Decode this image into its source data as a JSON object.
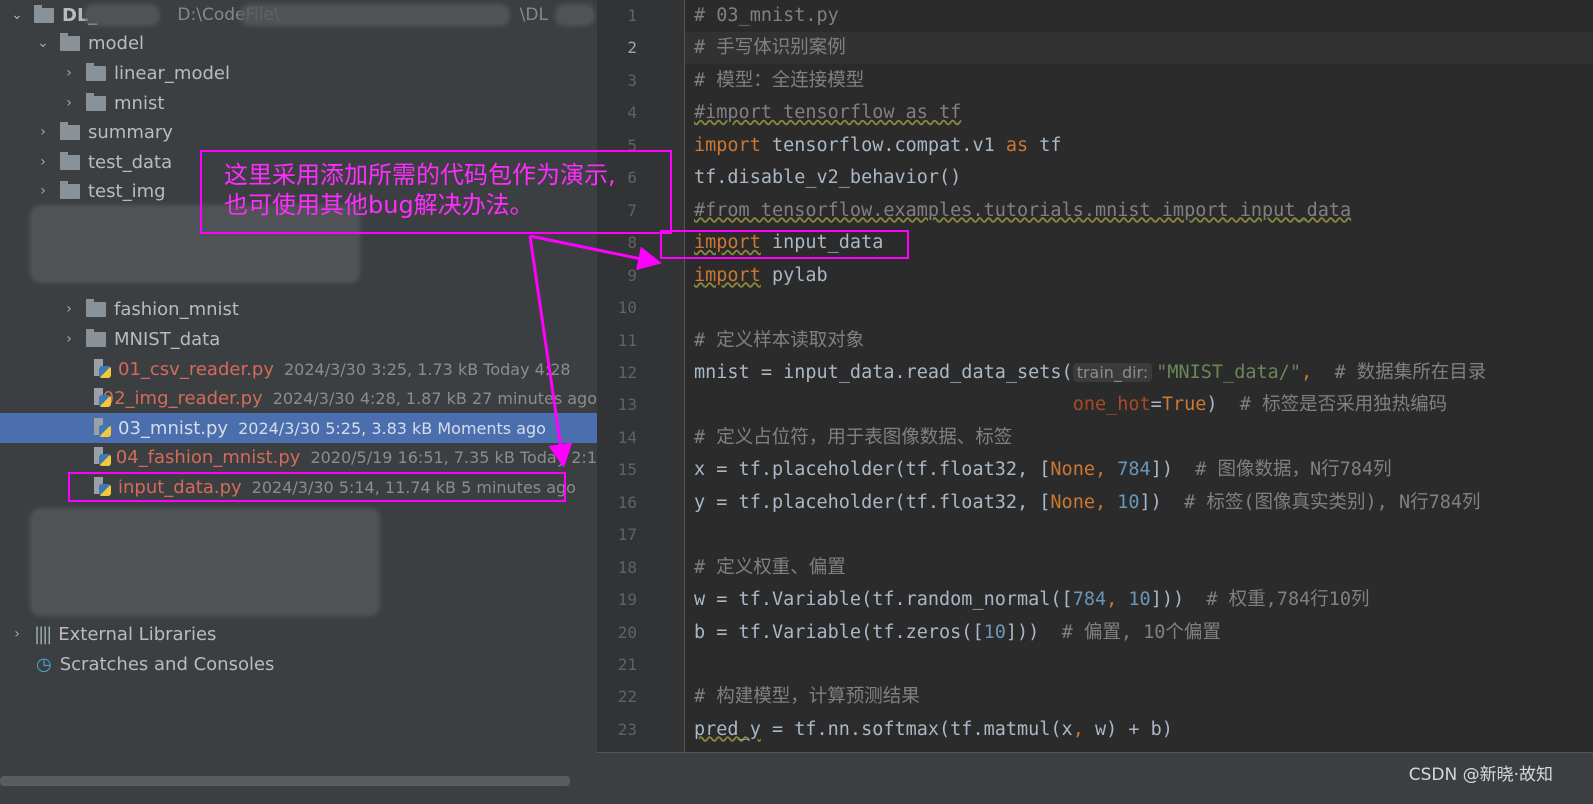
{
  "project_tree": {
    "root": {
      "label": "DL_",
      "path": "D:\\CodeFile\\",
      "path_tail": "\\DL"
    },
    "items": [
      {
        "label": "model",
        "type": "folder",
        "level": 1,
        "expanded": true
      },
      {
        "label": "linear_model",
        "type": "folder",
        "level": 2,
        "expanded": false
      },
      {
        "label": "mnist",
        "type": "folder",
        "level": 2,
        "expanded": false
      },
      {
        "label": "summary",
        "type": "folder",
        "level": 1,
        "expanded": false
      },
      {
        "label": "test_data",
        "type": "folder",
        "level": 1,
        "expanded": false
      },
      {
        "label": "test_img",
        "type": "folder",
        "level": 1,
        "expanded": false
      },
      {
        "label": "fashion_mnist",
        "type": "folder",
        "level": 2,
        "expanded": false
      },
      {
        "label": "MNIST_data",
        "type": "folder",
        "level": 2,
        "expanded": false
      },
      {
        "label": "01_csv_reader.py",
        "type": "file",
        "meta": "2024/3/30 3:25, 1.73 kB Today 4:28"
      },
      {
        "label": "02_img_reader.py",
        "type": "file",
        "meta": "2024/3/30 4:28, 1.87 kB 27 minutes ago"
      },
      {
        "label": "03_mnist.py",
        "type": "file",
        "meta": "2024/3/30 5:25, 3.83 kB Moments ago",
        "selected": true
      },
      {
        "label": "04_fashion_mnist.py",
        "type": "file",
        "meta": "2020/5/19 16:51, 7.35 kB Today 2:1"
      },
      {
        "label": "input_data.py",
        "type": "file",
        "meta": "2024/3/30 5:14, 11.74 kB 5 minutes ago"
      }
    ],
    "external_libraries": "External Libraries",
    "scratches": "Scratches and Consoles"
  },
  "annotation": {
    "text_line1": "这里采用添加所需的代码包作为演示,",
    "text_line2": "也可使用其他bug解决办法。",
    "color": "#ff00ff"
  },
  "editor": {
    "current_line": 2,
    "lines": [
      [
        {
          "t": "# 03_mnist.py",
          "c": "cmt"
        }
      ],
      [
        {
          "t": "# 手写体识别案例",
          "c": "cmt"
        }
      ],
      [
        {
          "t": "# 模型：全连接模型",
          "c": "cmt"
        }
      ],
      [
        {
          "t": "#import tensorflow as tf",
          "c": "cmt wavy"
        }
      ],
      [
        {
          "t": "import",
          "c": "kw"
        },
        {
          "t": " tensorflow.compat.v1 ",
          "c": ""
        },
        {
          "t": "as",
          "c": "kw"
        },
        {
          "t": " tf",
          "c": ""
        }
      ],
      [
        {
          "t": "tf.disable_v2_behavior()",
          "c": ""
        }
      ],
      [
        {
          "t": "#from tensorflow.examples.tutorials.mnist import input_data",
          "c": "cmt wavy"
        }
      ],
      [
        {
          "t": "import",
          "c": "kw wavy"
        },
        {
          "t": " input_data",
          "c": ""
        }
      ],
      [
        {
          "t": "import",
          "c": "kw wavy"
        },
        {
          "t": " pylab",
          "c": ""
        }
      ],
      [],
      [
        {
          "t": "# 定义样本读取对象",
          "c": "cmt"
        }
      ],
      [
        {
          "t": "mnist = input_data.read_data_sets(",
          "c": ""
        },
        {
          "t": "train_dir:",
          "c": "hint"
        },
        {
          "t": "\"MNIST_data/\"",
          "c": "str"
        },
        {
          "t": ",",
          "c": "kw"
        },
        {
          "t": "  # 数据集所在目录",
          "c": "cmt"
        }
      ],
      [
        {
          "t": "                                  ",
          "c": ""
        },
        {
          "t": "one_hot",
          "c": "param"
        },
        {
          "t": "=",
          "c": ""
        },
        {
          "t": "True",
          "c": "kw"
        },
        {
          "t": ")  ",
          "c": ""
        },
        {
          "t": "# 标签是否采用独热编码",
          "c": "cmt"
        }
      ],
      [
        {
          "t": "# 定义占位符，用于表图像数据、标签",
          "c": "cmt"
        }
      ],
      [
        {
          "t": "x = tf.placeholder(tf.float32, [",
          "c": ""
        },
        {
          "t": "None",
          "c": "kw"
        },
        {
          "t": ", ",
          "c": "kw"
        },
        {
          "t": "784",
          "c": "num"
        },
        {
          "t": "])  ",
          "c": ""
        },
        {
          "t": "# 图像数据，N行784列",
          "c": "cmt"
        }
      ],
      [
        {
          "t": "y = tf.placeholder(tf.float32, [",
          "c": ""
        },
        {
          "t": "None",
          "c": "kw"
        },
        {
          "t": ", ",
          "c": "kw"
        },
        {
          "t": "10",
          "c": "num"
        },
        {
          "t": "])  ",
          "c": ""
        },
        {
          "t": "# 标签(图像真实类别), N行784列",
          "c": "cmt"
        }
      ],
      [],
      [
        {
          "t": "# 定义权重、偏置",
          "c": "cmt"
        }
      ],
      [
        {
          "t": "w = tf.Variable(tf.random_normal([",
          "c": ""
        },
        {
          "t": "784",
          "c": "num"
        },
        {
          "t": ", ",
          "c": "kw"
        },
        {
          "t": "10",
          "c": "num"
        },
        {
          "t": "]))  ",
          "c": ""
        },
        {
          "t": "# 权重,784行10列",
          "c": "cmt"
        }
      ],
      [
        {
          "t": "b = tf.Variable(tf.zeros([",
          "c": ""
        },
        {
          "t": "10",
          "c": "num"
        },
        {
          "t": "]))  ",
          "c": ""
        },
        {
          "t": "# 偏置, 10个偏置",
          "c": "cmt"
        }
      ],
      [],
      [
        {
          "t": "# 构建模型，计算预测结果",
          "c": "cmt"
        }
      ],
      [
        {
          "t": "pred_y",
          "c": "wavy"
        },
        {
          "t": " = tf.nn.softmax(tf.matmul(x",
          "c": ""
        },
        {
          "t": ", ",
          "c": "kw"
        },
        {
          "t": "w) + b)",
          "c": ""
        }
      ]
    ]
  },
  "watermark": "CSDN @新晓·故知"
}
